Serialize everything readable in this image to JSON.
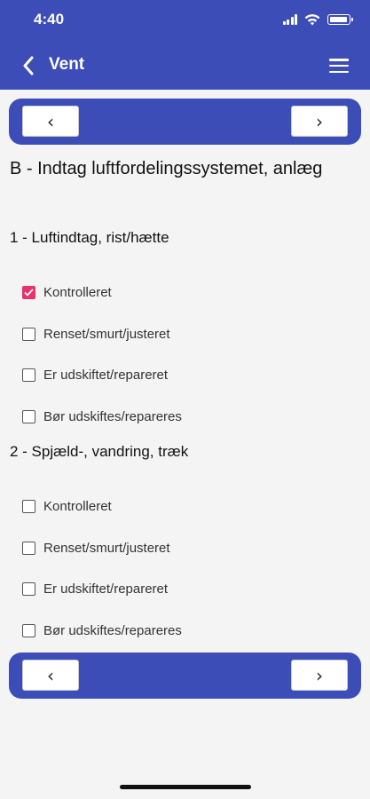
{
  "status": {
    "time": "4:40"
  },
  "header": {
    "title": "Vent",
    "back_icon": "chevron-left-icon",
    "menu_icon": "hamburger-menu-icon"
  },
  "nav": {
    "prev_label": "‹",
    "next_label": "›"
  },
  "section": {
    "title": "B - Indtag luftfordelingssystemet, anlæg"
  },
  "groups": [
    {
      "title": "1 - Luftindtag, rist/hætte",
      "items": [
        {
          "label": "Kontrolleret",
          "checked": true
        },
        {
          "label": "Renset/smurt/justeret",
          "checked": false
        },
        {
          "label": "Er udskiftet/repareret",
          "checked": false
        },
        {
          "label": "Bør udskiftes/repareres",
          "checked": false
        }
      ]
    },
    {
      "title": "2 - Spjæld-, vandring, træk",
      "items": [
        {
          "label": "Kontrolleret",
          "checked": false
        },
        {
          "label": "Renset/smurt/justeret",
          "checked": false
        },
        {
          "label": "Er udskiftet/repareret",
          "checked": false
        },
        {
          "label": "Bør udskiftes/repareres",
          "checked": false
        }
      ]
    }
  ],
  "colors": {
    "primary": "#3d4db7",
    "checked": "#e6336f",
    "background": "#f4f4f4"
  }
}
